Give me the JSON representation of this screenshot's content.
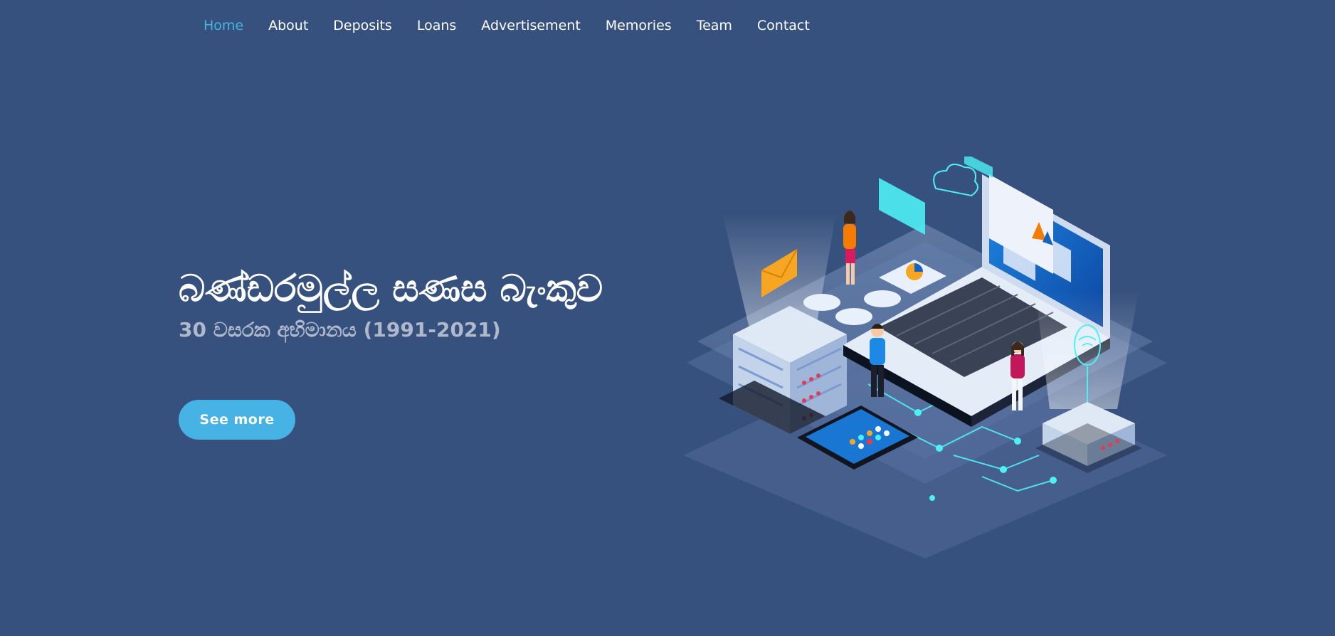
{
  "nav": {
    "items": [
      {
        "label": "Home",
        "active": true
      },
      {
        "label": "About",
        "active": false
      },
      {
        "label": "Deposits",
        "active": false
      },
      {
        "label": "Loans",
        "active": false
      },
      {
        "label": "Advertisement",
        "active": false
      },
      {
        "label": "Memories",
        "active": false
      },
      {
        "label": "Team",
        "active": false
      },
      {
        "label": "Contact",
        "active": false
      }
    ]
  },
  "hero": {
    "title": "බණ්ඩරමුල්ල සණස බැංකුව",
    "subtitle": "30 වසරක අභිමානය (1991-2021)",
    "cta_label": "See more"
  },
  "colors": {
    "background": "#37517e",
    "accent": "#47b2e4",
    "nav_text": "#ffffff"
  },
  "illustration": {
    "icon": "isometric-technology-illustration"
  }
}
